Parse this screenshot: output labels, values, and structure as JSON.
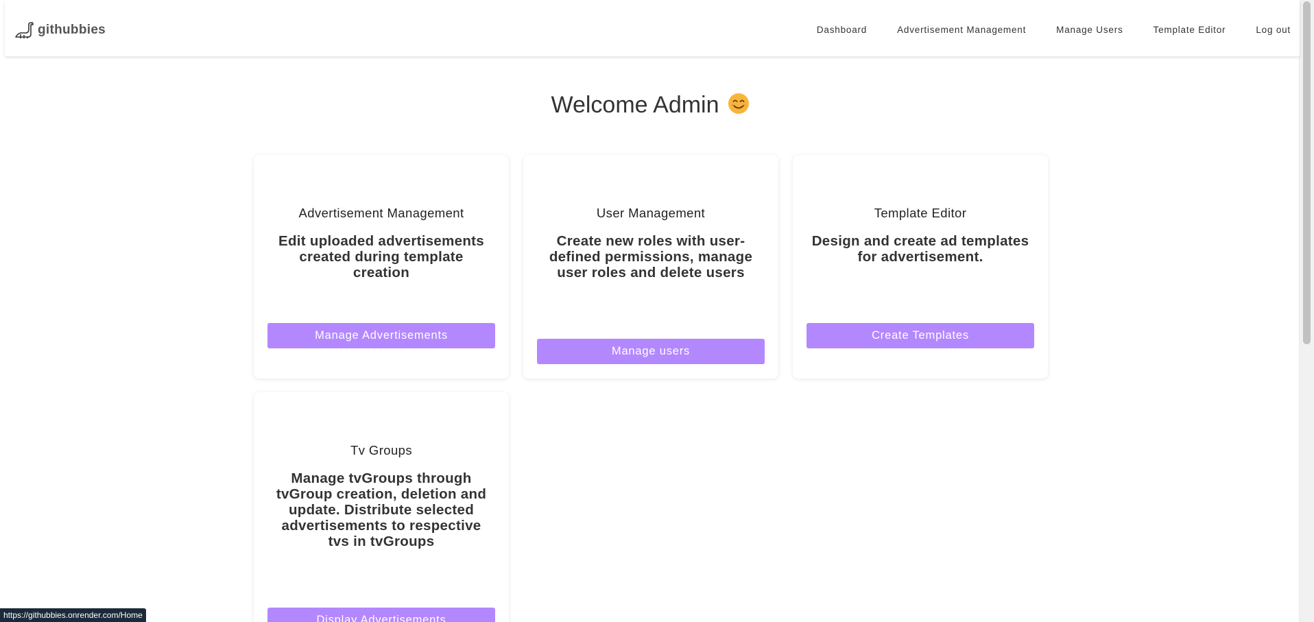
{
  "brand": {
    "name": "githubbies"
  },
  "nav": {
    "links": [
      "Dashboard",
      "Advertisement Management",
      "Manage Users",
      "Template Editor",
      "Log out"
    ]
  },
  "main": {
    "welcome": "Welcome Admin",
    "welcome_emoji": "smiling-face-icon",
    "cards": [
      {
        "title": "Advertisement Management",
        "text": "Edit uploaded advertisements created during template creation",
        "button": "Manage Advertisements"
      },
      {
        "title": "User Management",
        "text": "Create new roles with user-defined permissions, manage user roles and delete users",
        "button": "Manage users"
      },
      {
        "title": "Template Editor",
        "text": "Design and create ad templates for advertisement.",
        "button": "Create Templates"
      },
      {
        "title": "Tv Groups",
        "text": "Manage tvGroups through tvGroup creation, deletion and update. Distribute selected advertisements to respective tvs in tvGroups",
        "button": "Display Advertisements"
      }
    ]
  },
  "status_bar": {
    "url": "https://githubbies.onrender.com/Home"
  },
  "colors": {
    "accent": "#b388ff",
    "text": "#333333",
    "status_bg": "#1b2a3a"
  }
}
